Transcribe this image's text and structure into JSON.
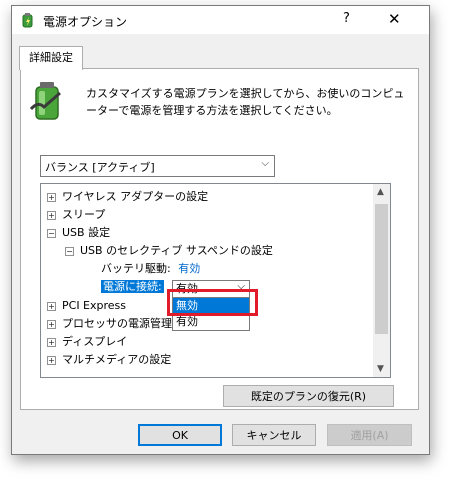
{
  "window": {
    "title": "電源オプション",
    "help_glyph": "?",
    "close_glyph": "✕"
  },
  "tabs": [
    {
      "label": "詳細設定",
      "active": true
    }
  ],
  "description": "カスタマイズする電源プランを選択してから、お使いのコンピューターで電源を管理する方法を選択してください。",
  "plan_select": {
    "value": "バランス [アクティブ]"
  },
  "tree": {
    "items": [
      {
        "label": "ワイヤレス アダプターの設定",
        "expander": "+"
      },
      {
        "label": "スリープ",
        "expander": "+"
      },
      {
        "label": "USB 設定",
        "expander": "−"
      },
      {
        "label": "USB のセレクティブ サスペンドの設定",
        "expander": "−"
      },
      {
        "label": "バッテリ駆動:",
        "value": "有効"
      },
      {
        "label": "電源に接続:",
        "value": "有効"
      },
      {
        "label": "PCI Express",
        "expander": "+"
      },
      {
        "label": "プロセッサの電源管理",
        "expander": "+"
      },
      {
        "label": "ディスプレイ",
        "expander": "+"
      },
      {
        "label": "マルチメディアの設定",
        "expander": "+"
      }
    ],
    "dropdown_options": [
      "無効",
      "有効"
    ],
    "highlighted_option": "無効"
  },
  "buttons": {
    "restore": "既定のプランの復元(R)",
    "ok": "OK",
    "cancel": "キャンセル",
    "apply": "適用(A)"
  },
  "colors": {
    "selection": "#0078d7",
    "highlight_box": "#e21b2b"
  }
}
